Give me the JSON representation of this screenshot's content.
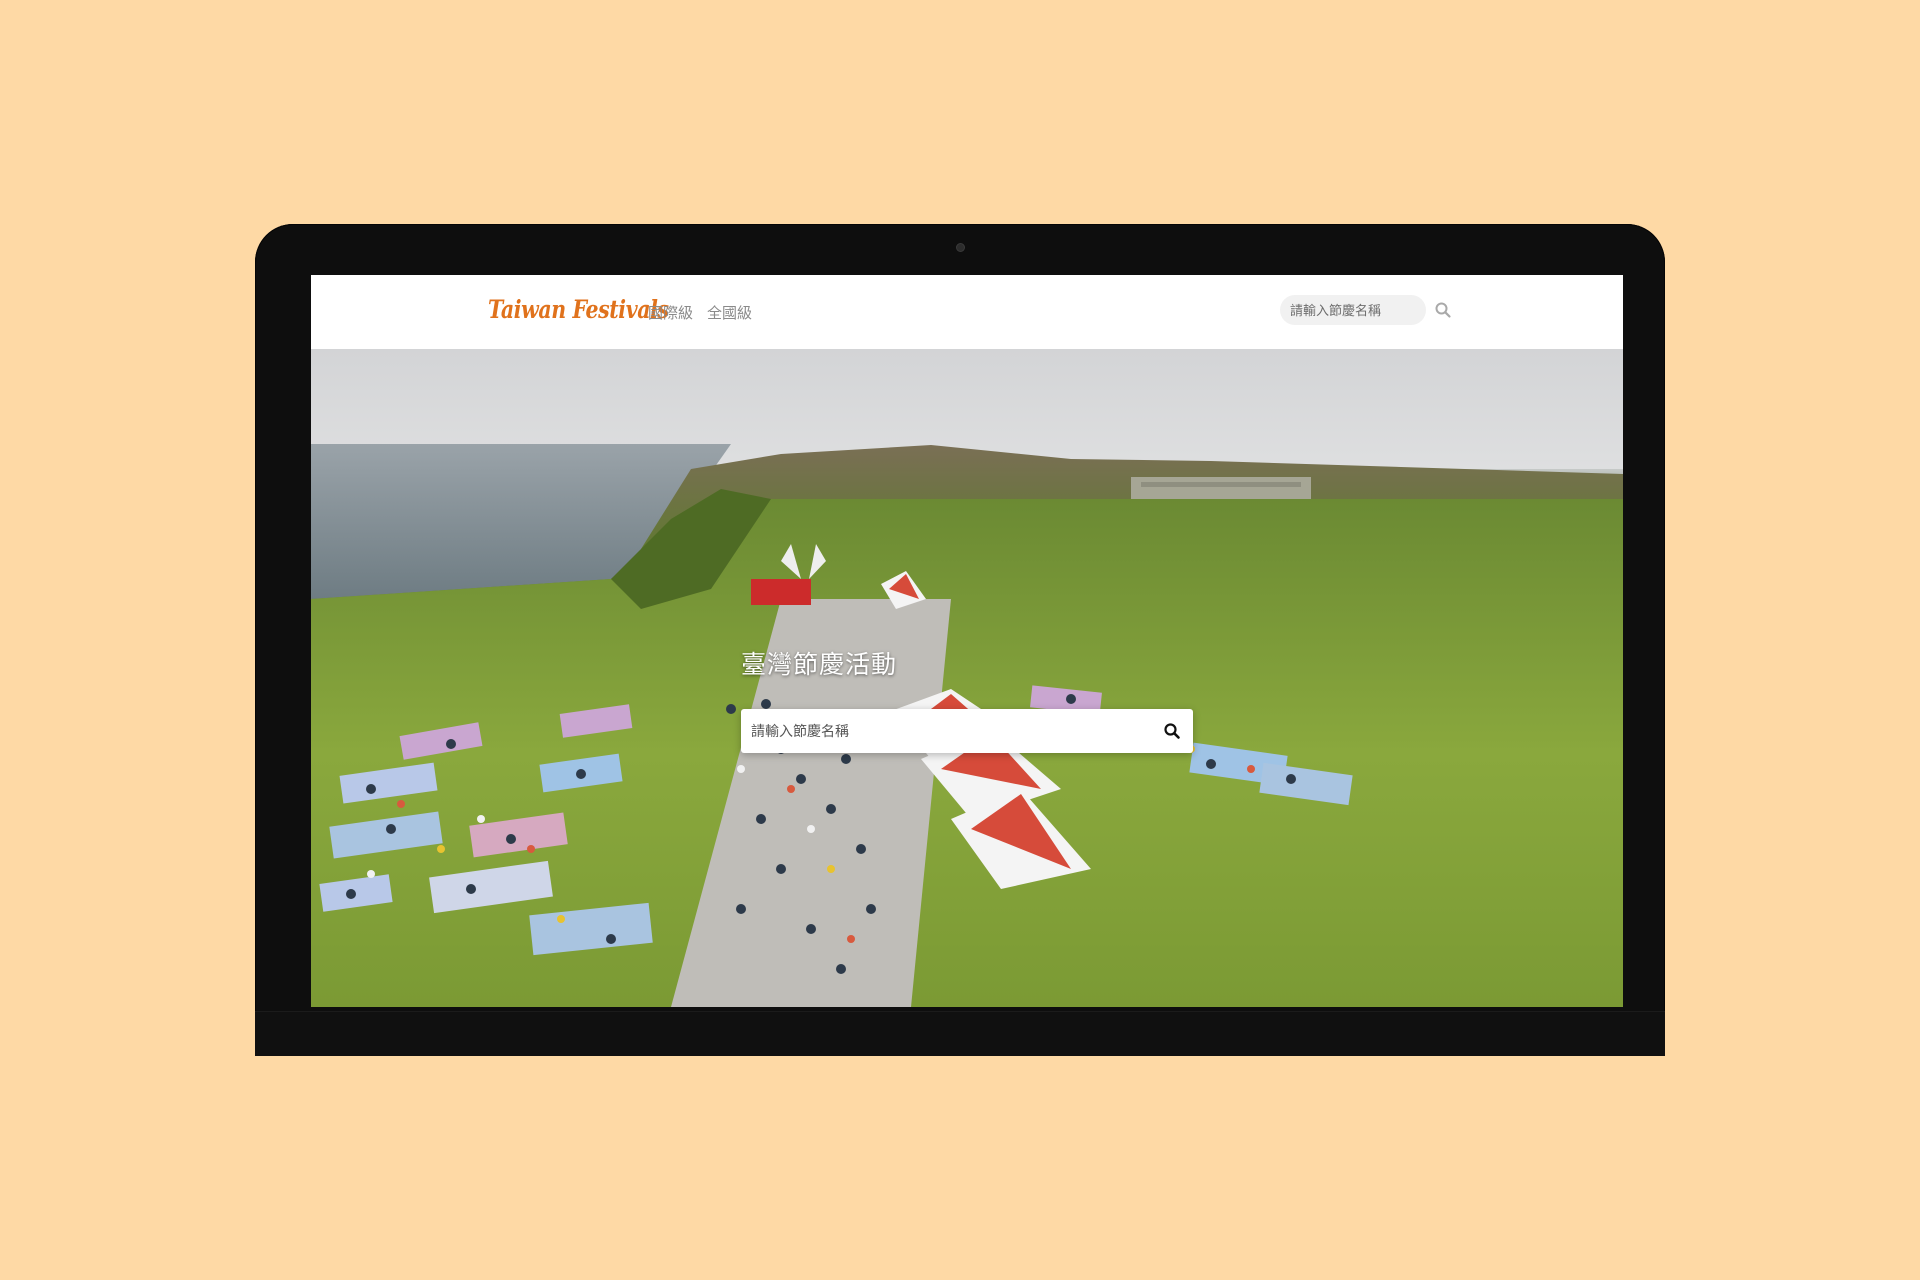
{
  "site": {
    "logo_text": "Taiwan Festivals",
    "brand_color": "#e0721c"
  },
  "nav": {
    "items": [
      {
        "label": "國際級"
      },
      {
        "label": "全國級"
      }
    ]
  },
  "header_search": {
    "placeholder": "請輸入節慶名稱",
    "icon": "search-icon"
  },
  "hero": {
    "title": "臺灣節慶活動",
    "search": {
      "placeholder": "請輸入節慶名稱",
      "icon": "search-icon"
    },
    "background": "photo-seaside-festival-crowd"
  },
  "frame": {
    "background_color": "#fed9a5",
    "device": "monitor"
  }
}
